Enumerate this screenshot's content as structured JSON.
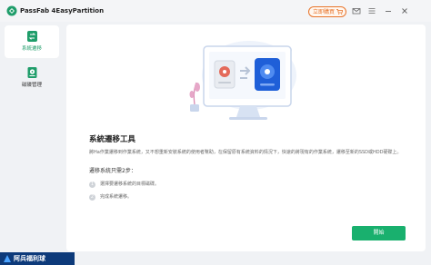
{
  "app": {
    "title": "PassFab 4EasyPartition"
  },
  "titlebar": {
    "buy_label": "立即購買",
    "icons": [
      "cart-icon",
      "mail-icon",
      "menu-icon",
      "minimize-icon",
      "close-icon"
    ]
  },
  "sidebar": {
    "items": [
      {
        "label": "系統遷移",
        "icon": "system-migrate-icon",
        "active": true
      },
      {
        "label": "磁碟管理",
        "icon": "disk-manage-icon",
        "active": false
      }
    ]
  },
  "main": {
    "title": "系統遷移工具",
    "description": "將Ha作業遷移到作業系統，又不想重新安裝系統的使用者幫助，在保留原有系統資料的情況下，快速的將現有的作業系統，遷移至新的SSD或HDD硬碟上。",
    "steps_title": "遷移系統只需2步：",
    "steps": [
      {
        "num": "1",
        "text": "選擇要遷移系統的目標磁碟。"
      },
      {
        "num": "2",
        "text": "完成系統遷移。"
      }
    ],
    "start_label": "開始"
  },
  "watermark": {
    "text": "阿兵福利球"
  },
  "colors": {
    "accent": "#19b06e",
    "buy": "#e8742a",
    "watermark_bg": "#0d3a7a"
  }
}
